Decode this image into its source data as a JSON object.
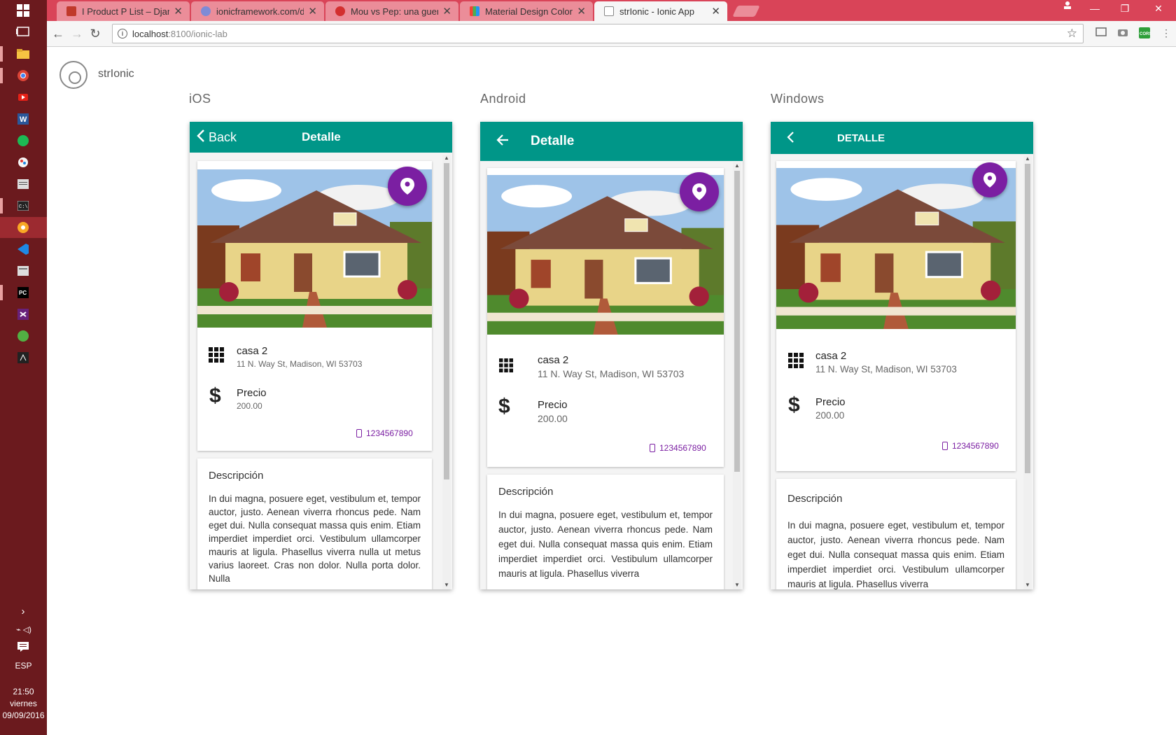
{
  "taskbar": {
    "icons": [
      "windows-start-icon",
      "task-view-icon",
      "file-explorer-icon",
      "chrome-icon",
      "youtube-icon",
      "word-icon",
      "spotify-icon",
      "paint-icon",
      "notepad-icon",
      "terminal-icon",
      "canary-icon",
      "vscode-icon",
      "app-icon",
      "pycharm-icon",
      "visual-studio-icon",
      "xbox-icon",
      "misc-icon"
    ],
    "language": "ESP",
    "clock": {
      "time": "21:50",
      "day": "viernes",
      "date": "09/09/2016"
    }
  },
  "browser": {
    "tabs": [
      {
        "title": "I Product P List – Django",
        "fav_color": "#c0392b",
        "active": false
      },
      {
        "title": "ionicframework.com/doc",
        "fav_color": "#7e8bd6",
        "active": false
      },
      {
        "title": "Mou vs Pep: una guerra d",
        "fav_color": "#d32f2f",
        "active": false
      },
      {
        "title": "Material Design Colors |",
        "fav_color": "#4caf50",
        "active": false
      },
      {
        "title": "strIonic - Ionic App",
        "fav_color": "#888888",
        "active": true
      }
    ],
    "url": "localhost:8100/ionic-lab",
    "host": "localhost",
    "path": ":8100/ionic-lab"
  },
  "lab": {
    "app_name": "strIonic",
    "platforms": [
      "iOS",
      "Android",
      "Windows"
    ]
  },
  "detail": {
    "ios_back": "Back",
    "ios_title": "Detalle",
    "android_title": "Detalle",
    "windows_title": "DETALLE",
    "name": "casa 2",
    "address": "11 N. Way St, Madison, WI 53703",
    "price_label": "Precio",
    "price": "200.00",
    "phone": "1234567890",
    "desc_title": "Descripción",
    "desc_ios": "In dui magna, posuere eget, vestibulum et, tempor auctor, justo. Aenean viverra rhoncus pede. Nam eget dui. Nulla consequat massa quis enim. Etiam imperdiet imperdiet orci.  Vestibulum ullamcorper mauris at ligula. Phasellus viverra nulla ut metus varius laoreet. Cras non dolor. Nulla porta dolor. Nulla",
    "desc_android": "In dui magna, posuere eget, vestibulum et, tempor auctor, justo. Aenean viverra rhoncus pede. Nam eget dui. Nulla consequat massa quis enim. Etiam imperdiet imperdiet orci.  Vestibulum ullamcorper mauris at ligula. Phasellus viverra",
    "desc_windows": "In dui magna, posuere eget, vestibulum et, tempor auctor, justo. Aenean viverra rhoncus pede. Nam eget dui. Nulla consequat massa quis enim. Etiam imperdiet imperdiet orci.  Vestibulum ullamcorper mauris at ligula. Phasellus viverra"
  },
  "colors": {
    "toolbar": "#009688",
    "fab": "#7b1fa2",
    "taskbar": "#6b1a1e",
    "tabstrip": "#d94458"
  }
}
